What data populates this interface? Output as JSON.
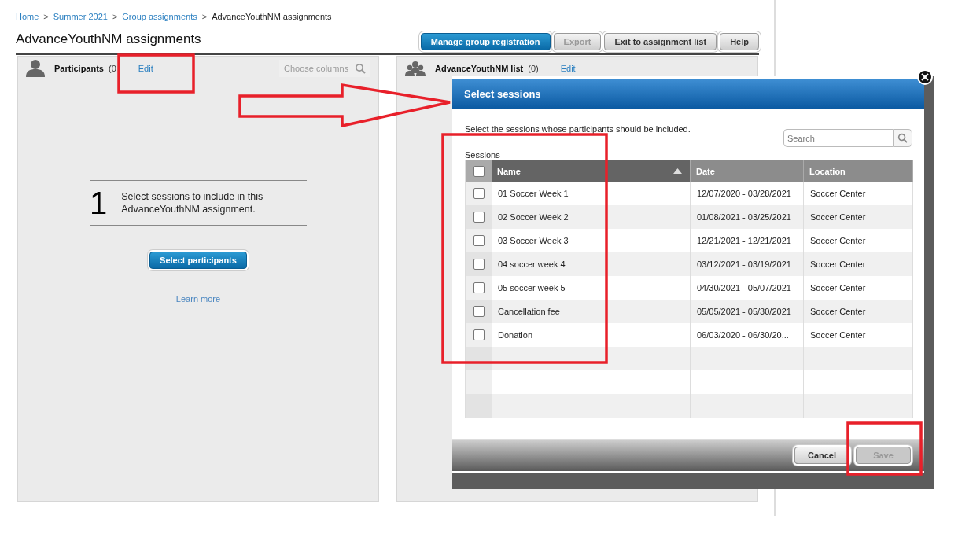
{
  "breadcrumb": [
    {
      "label": "Home",
      "kind": "link"
    },
    {
      "label": "Summer 2021",
      "kind": "link"
    },
    {
      "label": "Group assignments",
      "kind": "link"
    },
    {
      "label": "AdvanceYouthNM assignments",
      "kind": "current"
    }
  ],
  "breadcrumb_separator": ">",
  "page_title": "AdvanceYouthNM assignments",
  "toolbar": [
    {
      "label": "Manage group registration",
      "kind": "primary",
      "disabled": false
    },
    {
      "label": "Export",
      "kind": "default",
      "disabled": true
    },
    {
      "label": "Exit to assignment list",
      "kind": "default",
      "disabled": false
    },
    {
      "label": "Help",
      "kind": "default",
      "disabled": false
    }
  ],
  "participants_panel": {
    "title": "Participants",
    "count": "(0",
    "edit_link": "Edit",
    "choose_columns": "Choose columns",
    "step_number": "1",
    "step_text": "Select sessions to include in this AdvanceYouthNM assignment.",
    "button": "Select participants",
    "learn_more": "Learn more"
  },
  "list_panel": {
    "title": "AdvanceYouthNM list",
    "count": "(0)",
    "edit_link": "Edit"
  },
  "dialog": {
    "title": "Select sessions",
    "instruction": "Select the sessions whose participants should be included.",
    "search": {
      "placeholder": "Search"
    },
    "table_label": "Sessions",
    "select_all_checked": false,
    "columns": [
      {
        "label": "Name",
        "sorted": true
      },
      {
        "label": "Date",
        "sorted": false
      },
      {
        "label": "Location",
        "sorted": false
      }
    ],
    "rows": [
      {
        "name": "01 Soccer Week 1",
        "date": "12/07/2020 - 03/28/2021",
        "location": "Soccer Center",
        "checked": false
      },
      {
        "name": "02 Soccer Week 2",
        "date": "01/08/2021 - 03/25/2021",
        "location": "Soccer Center",
        "checked": false
      },
      {
        "name": "03 Soccer Week 3",
        "date": "12/21/2021 - 12/21/2021",
        "location": "Soccer Center",
        "checked": false
      },
      {
        "name": "04 soccer week 4",
        "date": "03/12/2021 - 03/19/2021",
        "location": "Soccer Center",
        "checked": false
      },
      {
        "name": "05 soccer week 5",
        "date": "04/30/2021 - 05/07/2021",
        "location": "Soccer Center",
        "checked": false
      },
      {
        "name": "Cancellation fee",
        "date": "05/05/2021 - 05/30/2021",
        "location": "Soccer Center",
        "checked": false
      },
      {
        "name": "Donation",
        "date": "06/03/2020 - 06/30/20...",
        "location": "Soccer Center",
        "checked": false
      }
    ],
    "buttons": [
      {
        "label": "Cancel",
        "disabled": false
      },
      {
        "label": "Save",
        "disabled": true
      }
    ]
  }
}
